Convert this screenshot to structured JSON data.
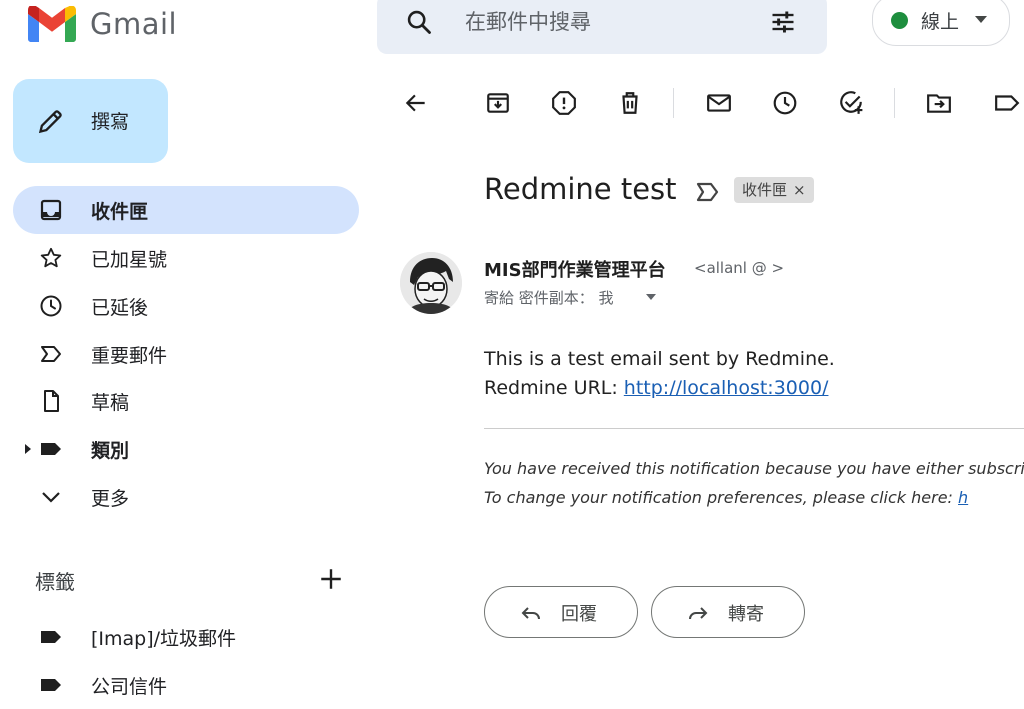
{
  "app": {
    "name": "Gmail"
  },
  "search": {
    "placeholder": "在郵件中搜尋"
  },
  "status": {
    "label": "線上",
    "color": "#1e8e3e"
  },
  "compose": {
    "label": "撰寫"
  },
  "sidebar": {
    "items": [
      {
        "label": "收件匣",
        "icon": "inbox-icon",
        "active": true
      },
      {
        "label": "已加星號",
        "icon": "star-icon"
      },
      {
        "label": "已延後",
        "icon": "clock-icon"
      },
      {
        "label": "重要郵件",
        "icon": "important-icon"
      },
      {
        "label": "草稿",
        "icon": "draft-icon"
      },
      {
        "label": "類別",
        "icon": "label-icon"
      },
      {
        "label": "更多",
        "icon": "chevron-down-icon"
      }
    ],
    "labels_title": "標籤",
    "labels": [
      {
        "label": "[Imap]/垃圾郵件",
        "icon": "label-icon"
      },
      {
        "label": "公司信件",
        "icon": "label-icon"
      }
    ]
  },
  "toolbar": {
    "icons": [
      "back-icon",
      "archive-icon",
      "report-spam-icon",
      "delete-icon",
      "mark-unread-icon",
      "snooze-icon",
      "add-task-icon",
      "move-to-icon",
      "labels-icon"
    ]
  },
  "email": {
    "subject": "Redmine test",
    "chip_label": "收件匣",
    "chip_close": "×",
    "sender_name": "MIS部門作業管理平台",
    "sender_email": "<allanl      @             >",
    "recipients": "寄給 密件副本： 我",
    "body_line1": "This is a test email sent by Redmine.",
    "body_line2_prefix": "Redmine URL: ",
    "body_link": "http://localhost:3000/",
    "note_line1": "You have received this notification because you have either subscribed to it, or are involved in it.",
    "note_line2_prefix": "To change your notification preferences, please click here: ",
    "note_link": "h"
  },
  "actions": {
    "reply": "回覆",
    "forward": "轉寄"
  }
}
